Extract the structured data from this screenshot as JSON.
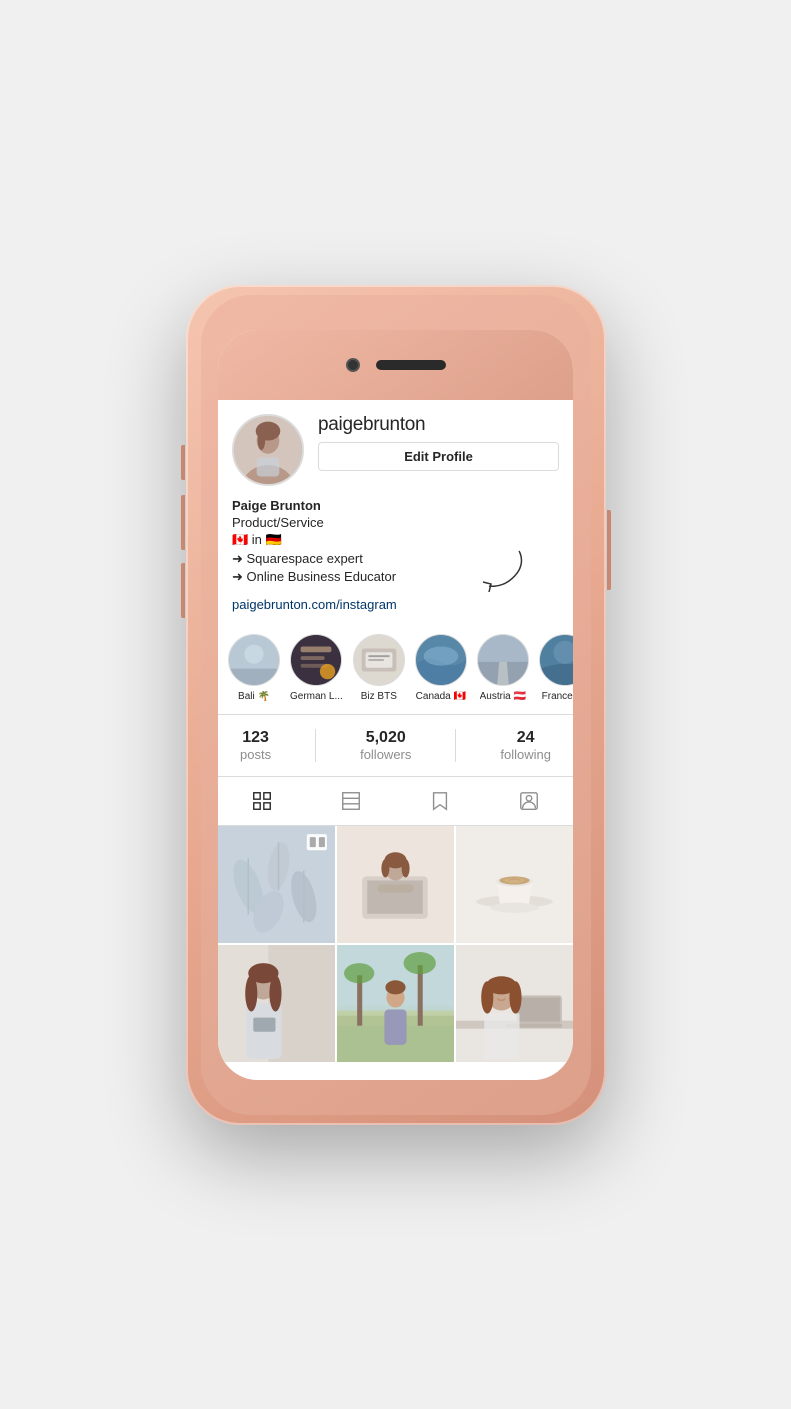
{
  "phone": {
    "camera_label": "front-camera",
    "speaker_label": "speaker"
  },
  "profile": {
    "username": "paigebrunton",
    "edit_button_label": "Edit Profile",
    "display_name": "Paige Brunton",
    "category": "Product/Service",
    "location_flags": "🇨🇦 in 🇩🇪",
    "bio_line1": "➜ Squarespace expert",
    "bio_line2": "➜ Online Business Educator",
    "link": "paigebrunton.com/instagram"
  },
  "highlights": [
    {
      "id": "hl1",
      "label": "Bali 🌴",
      "class": "hl-1"
    },
    {
      "id": "hl2",
      "label": "German L...",
      "class": "hl-2"
    },
    {
      "id": "hl3",
      "label": "Biz BTS",
      "class": "hl-3"
    },
    {
      "id": "hl4",
      "label": "Canada 🇨🇦",
      "class": "hl-4"
    },
    {
      "id": "hl5",
      "label": "Austria 🇦🇹",
      "class": "hl-5"
    },
    {
      "id": "hl6",
      "label": "France 🇫🇷",
      "class": "hl-6"
    }
  ],
  "stats": {
    "posts_count": "123",
    "posts_label": "posts",
    "followers_count": "5,020",
    "followers_label": "followers",
    "following_count": "24",
    "following_label": "following"
  },
  "tabs": {
    "grid_icon": "grid",
    "feed_icon": "square",
    "saved_icon": "bookmark",
    "tagged_icon": "person-square"
  }
}
